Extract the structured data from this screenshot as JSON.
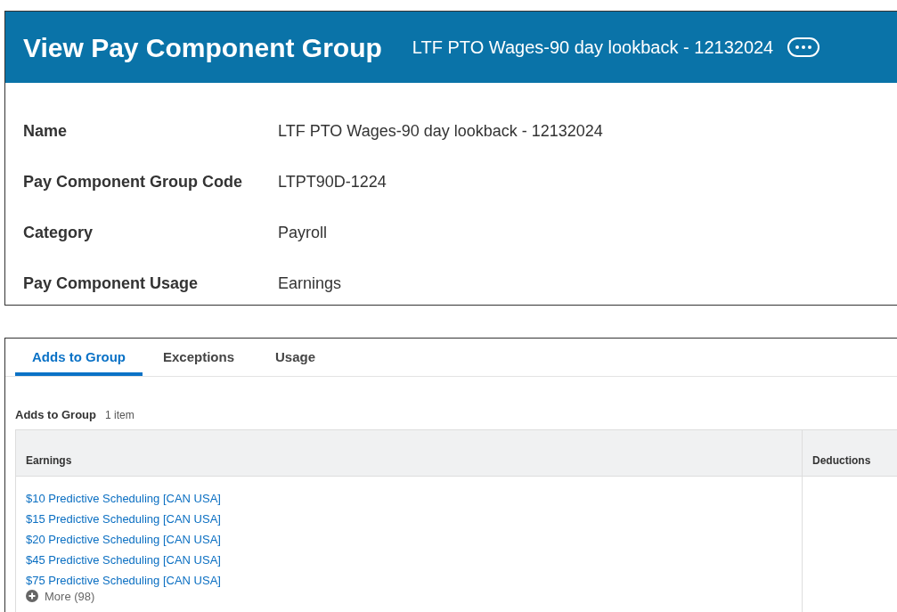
{
  "header": {
    "title": "View Pay Component Group",
    "subtitle": "LTF PTO Wages-90 day lookback - 12132024"
  },
  "fields": [
    {
      "label": "Name",
      "value": "LTF PTO Wages-90 day lookback - 12132024"
    },
    {
      "label": "Pay Component Group Code",
      "value": "LTPT90D-1224"
    },
    {
      "label": "Category",
      "value": "Payroll"
    },
    {
      "label": "Pay Component Usage",
      "value": "Earnings"
    }
  ],
  "tabs": [
    {
      "label": "Adds to Group",
      "selected": true
    },
    {
      "label": "Exceptions",
      "selected": false
    },
    {
      "label": "Usage",
      "selected": false
    }
  ],
  "section": {
    "title": "Adds to Group",
    "count": "1 item"
  },
  "table": {
    "columns": [
      "Earnings",
      "Deductions"
    ],
    "earnings": [
      "$10 Predictive Scheduling [CAN USA]",
      "$15 Predictive Scheduling [CAN USA]",
      "$20 Predictive Scheduling [CAN USA]",
      "$45 Predictive Scheduling [CAN USA]",
      "$75 Predictive Scheduling [CAN USA]"
    ],
    "more": "More (98)"
  }
}
